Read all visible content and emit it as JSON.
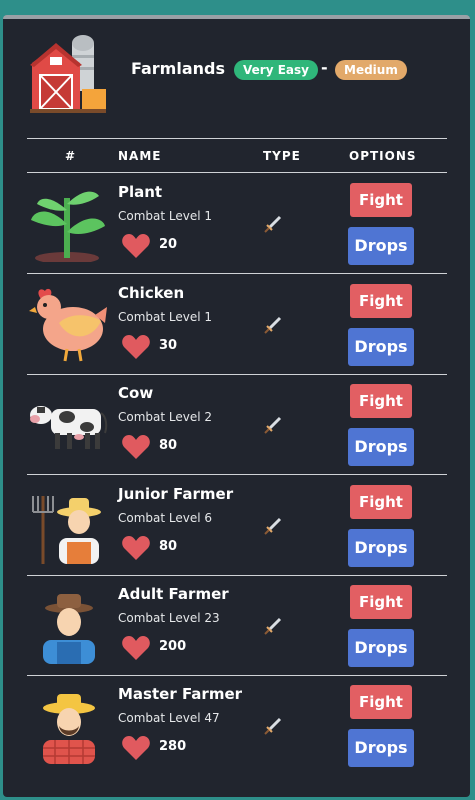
{
  "area": {
    "title": "Farmlands",
    "difficulty_easy": "Very Easy",
    "separator": "-",
    "difficulty_medium": "Medium"
  },
  "columns": {
    "num": "#",
    "name": "NAME",
    "type": "TYPE",
    "options": "OPTIONS"
  },
  "buttons": {
    "fight": "Fight",
    "drops": "Drops"
  },
  "monsters": [
    {
      "name": "Plant",
      "level": "Combat Level 1",
      "hp": "20",
      "icon": "plant-icon",
      "type_icon": "sword-icon"
    },
    {
      "name": "Chicken",
      "level": "Combat Level 1",
      "hp": "30",
      "icon": "chicken-icon",
      "type_icon": "sword-icon"
    },
    {
      "name": "Cow",
      "level": "Combat Level 2",
      "hp": "80",
      "icon": "cow-icon",
      "type_icon": "sword-icon"
    },
    {
      "name": "Junior Farmer",
      "level": "Combat Level 6",
      "hp": "80",
      "icon": "junior-farmer-icon",
      "type_icon": "sword-icon"
    },
    {
      "name": "Adult Farmer",
      "level": "Combat Level 23",
      "hp": "200",
      "icon": "adult-farmer-icon",
      "type_icon": "sword-icon"
    },
    {
      "name": "Master Farmer",
      "level": "Combat Level 47",
      "hp": "280",
      "icon": "master-farmer-icon",
      "type_icon": "sword-icon"
    }
  ],
  "colors": {
    "panel": "#21252e",
    "fight": "#e25f63",
    "drops": "#4f75d3",
    "very_easy": "#2fb67a",
    "medium": "#e2a96a"
  }
}
